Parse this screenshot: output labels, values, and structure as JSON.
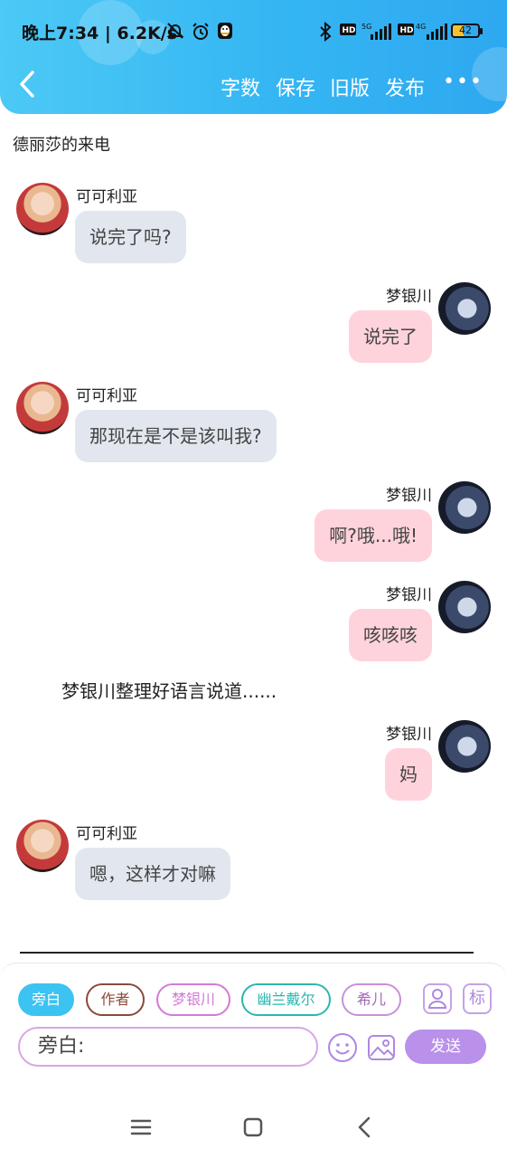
{
  "status_bar": {
    "time_speed": "晚上7:34 | 6.2K/s",
    "battery": "42",
    "icons": [
      "mute-bell-icon",
      "alarm-icon",
      "qq-icon",
      "bluetooth-icon",
      "hd-icon",
      "signal-5g-icon",
      "hd-icon",
      "signal-4g-icon",
      "battery-icon"
    ]
  },
  "toolbar": {
    "back_icon": "chevron-left-icon",
    "items": [
      "字数",
      "保存",
      "旧版",
      "发布"
    ],
    "more_label": "•••"
  },
  "chat": {
    "title": "德丽莎的来电",
    "messages": [
      {
        "side": "left",
        "name": "可可利亚",
        "text": "说完了吗?"
      },
      {
        "side": "right",
        "name": "梦银川",
        "text": "说完了"
      },
      {
        "side": "left",
        "name": "可可利亚",
        "text": "那现在是不是该叫我?"
      },
      {
        "side": "right",
        "name": "梦银川",
        "text": "啊?哦...哦!"
      },
      {
        "side": "right",
        "name": "梦银川",
        "text": "咳咳咳"
      },
      {
        "side": "right",
        "name": "梦银川",
        "text": "妈"
      },
      {
        "side": "left",
        "name": "可可利亚",
        "text": "嗯，这样才对嘛"
      }
    ],
    "narration": "梦银川整理好语言说道......"
  },
  "input_panel": {
    "roles": [
      "旁白",
      "作者",
      "梦银川",
      "幽兰戴尔",
      "希儿"
    ],
    "role_colors": [
      "#3cc3f2",
      "#8a4a3a",
      "#d37ad6",
      "#2bb7b0",
      "#c891d6"
    ],
    "icon_person": "person-icon",
    "icon_mark_label": "标",
    "input_value": "旁白:",
    "emoji_icon": "emoji-icon",
    "image_icon": "image-icon",
    "send_label": "发送"
  },
  "nav_bar": {
    "icons": [
      "menu-icon",
      "home-square-icon",
      "back-triangle-icon"
    ]
  }
}
